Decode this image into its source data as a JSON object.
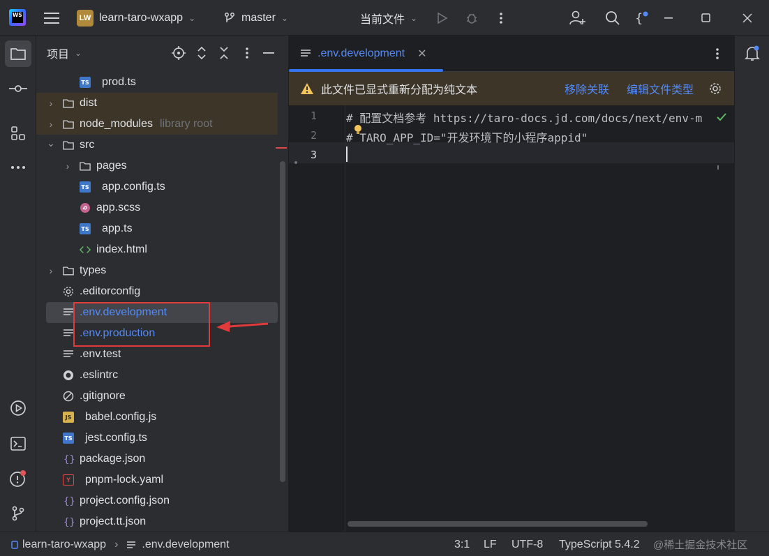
{
  "titlebar": {
    "project_badge": "LW",
    "project_name": "learn-taro-wxapp",
    "branch": "master",
    "run_config": "当前文件"
  },
  "project_panel": {
    "title": "项目",
    "tree": [
      {
        "label": "prod.ts",
        "icon": "ts-icon",
        "indent": 2,
        "kind": "file"
      },
      {
        "label": "dist",
        "icon": "folder-icon",
        "indent": 1,
        "kind": "folder",
        "highlight": true
      },
      {
        "label": "node_modules",
        "extra": "library root",
        "icon": "folder-icon",
        "indent": 1,
        "kind": "folder",
        "highlight": true
      },
      {
        "label": "src",
        "icon": "folder-icon",
        "indent": 1,
        "kind": "folder-open"
      },
      {
        "label": "pages",
        "icon": "folder-icon",
        "indent": 2,
        "kind": "folder"
      },
      {
        "label": "app.config.ts",
        "icon": "ts-icon",
        "indent": 2,
        "kind": "file"
      },
      {
        "label": "app.scss",
        "icon": "scss-icon",
        "indent": 2,
        "kind": "file"
      },
      {
        "label": "app.ts",
        "icon": "ts-icon",
        "indent": 2,
        "kind": "file"
      },
      {
        "label": "index.html",
        "icon": "html-icon",
        "indent": 2,
        "kind": "file"
      },
      {
        "label": "types",
        "icon": "folder-icon",
        "indent": 1,
        "kind": "folder"
      },
      {
        "label": ".editorconfig",
        "icon": "gear-icon",
        "indent": 1,
        "kind": "file"
      },
      {
        "label": ".env.development",
        "icon": "text-icon",
        "indent": 1,
        "kind": "file",
        "selected": true,
        "blue": true
      },
      {
        "label": ".env.production",
        "icon": "text-icon",
        "indent": 1,
        "kind": "file",
        "blue": true
      },
      {
        "label": ".env.test",
        "icon": "text-icon",
        "indent": 1,
        "kind": "file"
      },
      {
        "label": ".eslintrc",
        "icon": "eslint-icon",
        "indent": 1,
        "kind": "file"
      },
      {
        "label": ".gitignore",
        "icon": "ignore-icon",
        "indent": 1,
        "kind": "file"
      },
      {
        "label": "babel.config.js",
        "icon": "js-icon",
        "indent": 1,
        "kind": "file"
      },
      {
        "label": "jest.config.ts",
        "icon": "ts-icon",
        "indent": 1,
        "kind": "file"
      },
      {
        "label": "package.json",
        "icon": "json-icon",
        "indent": 1,
        "kind": "file"
      },
      {
        "label": "pnpm-lock.yaml",
        "icon": "yaml-icon",
        "indent": 1,
        "kind": "file"
      },
      {
        "label": "project.config.json",
        "icon": "json-icon",
        "indent": 1,
        "kind": "file"
      },
      {
        "label": "project.tt.json",
        "icon": "json-icon",
        "indent": 1,
        "kind": "file"
      }
    ]
  },
  "editor": {
    "tab_label": ".env.development",
    "banner_text": "此文件已显式重新分配为纯文本",
    "banner_action_1": "移除关联",
    "banner_action_2": "编辑文件类型",
    "lines": [
      {
        "num": "1",
        "text": "# 配置文档参考 https://taro-docs.jd.com/docs/next/env-m"
      },
      {
        "num": "2",
        "text": "# TARO_APP_ID=\"开发环境下的小程序appid\""
      },
      {
        "num": "3",
        "text": ""
      }
    ]
  },
  "statusbar": {
    "project": "learn-taro-wxapp",
    "file": ".env.development",
    "position": "3:1",
    "line_ending": "LF",
    "encoding": "UTF-8",
    "language": "TypeScript 5.4.2",
    "watermark": "@稀土掘金技术社区"
  },
  "colors": {
    "accent": "#3574f0",
    "highlight_row": "#3d3528",
    "annotation_red": "#e03a3a"
  }
}
